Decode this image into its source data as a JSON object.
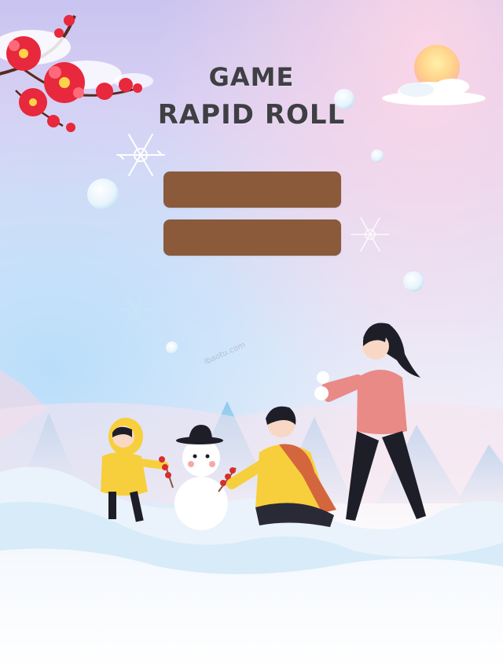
{
  "game": {
    "title_line1": "GAME",
    "title_line2": "RAPID ROLL"
  },
  "menu": {
    "buttons": [
      {
        "label": ""
      },
      {
        "label": ""
      }
    ],
    "button_color": "#8a5a3b"
  },
  "watermark": "ibaotu.com",
  "scene": {
    "theme": "winter snow family illustration",
    "accent_colors": {
      "plum_blossom": "#e8283c",
      "sun": "#ffd978",
      "coat_pink": "#e98a86",
      "coat_yellow": "#f7cf3c",
      "scarf": "#d4663d",
      "mountain": "#a9d4ee"
    }
  }
}
